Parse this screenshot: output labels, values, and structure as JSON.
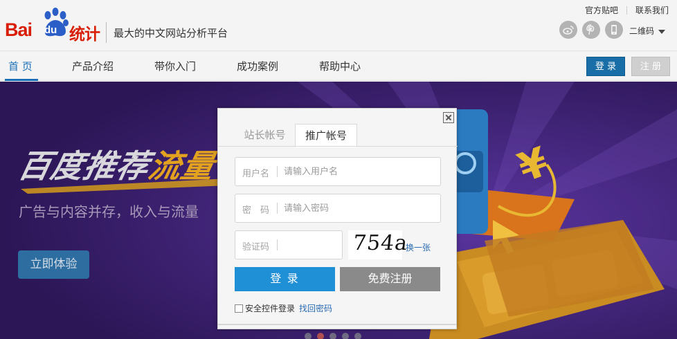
{
  "brand": {
    "logo_left": "Bai",
    "logo_paw_text": "du",
    "logo_right": "统计",
    "slogan": "最大的中文网站分析平台"
  },
  "toplinks": {
    "tieba": "官方贴吧",
    "contact": "联系我们"
  },
  "social": {
    "icons": [
      "weibo-icon",
      "pinterest-icon",
      "mobile-app-icon"
    ],
    "qrcode_label": "二维码"
  },
  "nav": {
    "items": [
      "首 页",
      "产品介绍",
      "带你入门",
      "成功案例",
      "帮助中心"
    ],
    "active_index": 0,
    "login": "登 录",
    "register": "注 册"
  },
  "banner": {
    "headline_main": "百度推荐",
    "headline_highlight": "流量",
    "subtitle": "广告与内容并存，收入与流量",
    "cta": "立即体验",
    "dots": 5,
    "active_dot": 1
  },
  "dialog": {
    "tabs": [
      "站长帐号",
      "推广帐号"
    ],
    "active_tab": 1,
    "username": {
      "label": "用户名",
      "placeholder": "请输入用户名",
      "value": ""
    },
    "password": {
      "label": "密　码",
      "placeholder": "请输入密码",
      "value": ""
    },
    "captcha": {
      "label": "验证码",
      "value": "",
      "image_text": "754a",
      "refresh": "换一张"
    },
    "login_button": "登 录",
    "register_button": "免费注册",
    "secure_login": "安全控件登录",
    "find_password": "找回密码"
  },
  "colors": {
    "brand_red": "#d81e06",
    "primary_blue": "#1f8fd6",
    "nav_active": "#1b6fb8",
    "link_blue": "#2a6cb4"
  }
}
